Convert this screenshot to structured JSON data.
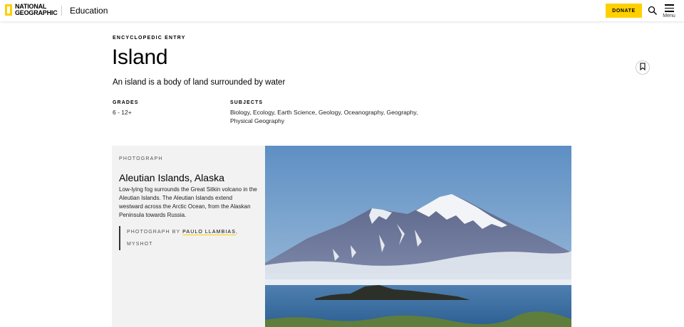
{
  "header": {
    "logo_line1": "NATIONAL",
    "logo_line2": "GEOGRAPHIC",
    "section": "Education",
    "donate_label": "DONATE",
    "menu_label": "Menu"
  },
  "article": {
    "kicker": "ENCYCLOPEDIC ENTRY",
    "title": "Island",
    "subtitle": "An island is a body of land surrounded by water",
    "grades_label": "GRADES",
    "grades_value": "6 - 12+",
    "subjects_label": "SUBJECTS",
    "subjects_line1": "Biology, Ecology, Earth Science, Geology, Oceanography, Geography,",
    "subjects_line2": "Physical Geography"
  },
  "photo_card": {
    "kicker": "PHOTOGRAPH",
    "title": "Aleutian Islands, Alaska",
    "body": "Low-lying fog surrounds the Great Sitkin volcano in the Aleutian Islands. The Aleutian Islands extend westward across the Arctic Ocean, from the Alaskan Peninsula towards Russia.",
    "credit_prefix": "PHOTOGRAPH BY ",
    "credit_name": "PAULO LLAMBIAS",
    "credit_suffix": ",",
    "credit_source": "MYSHOT"
  },
  "colors": {
    "brand_yellow": "#ffd000",
    "card_bg": "#f2f2f2"
  },
  "icons": {
    "search": "search-icon",
    "menu": "hamburger-icon",
    "bookmark": "bookmark-icon"
  }
}
